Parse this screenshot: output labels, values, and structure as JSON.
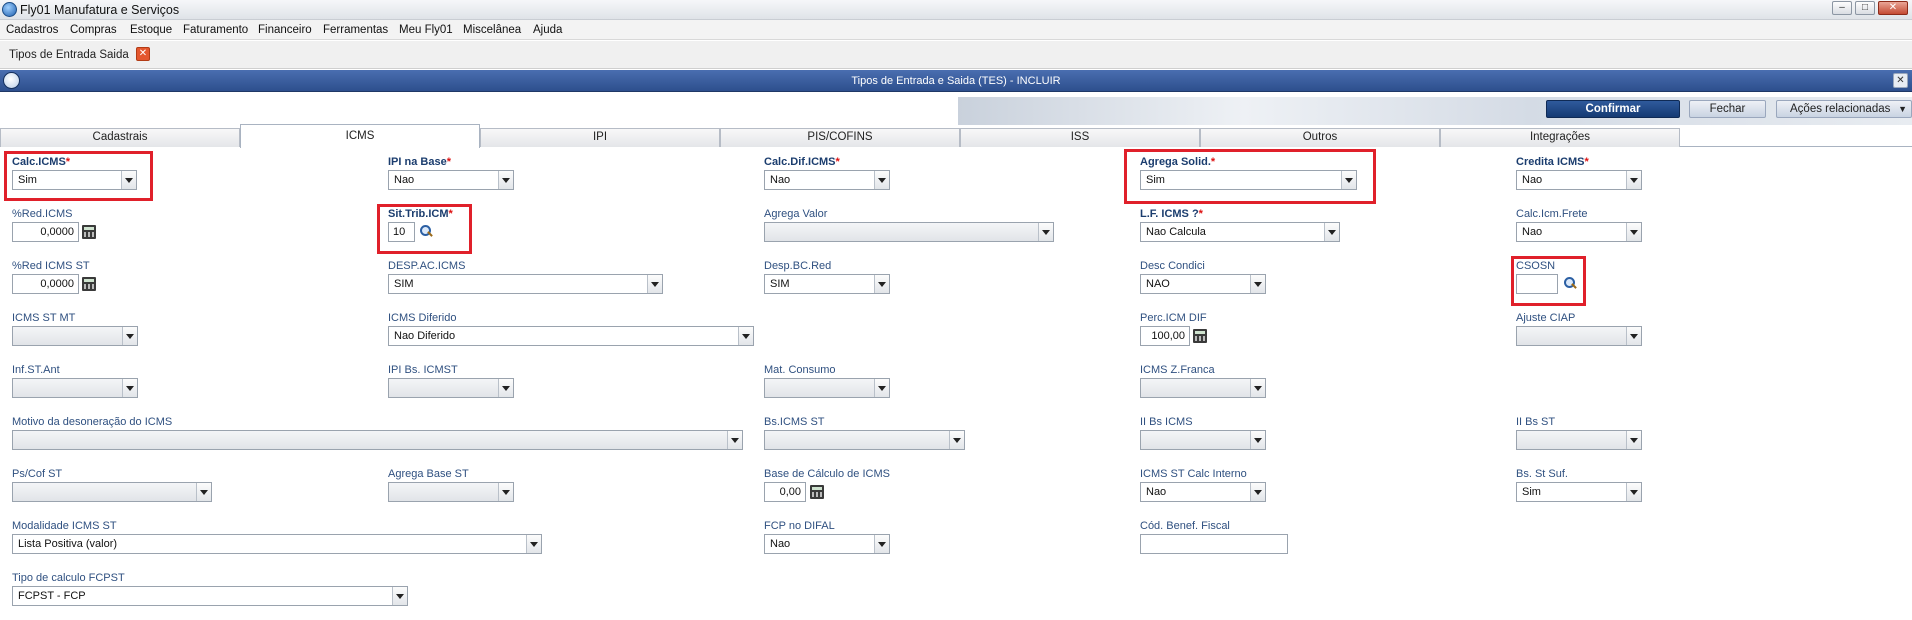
{
  "app": {
    "title": "Fly01 Manufatura e Serviços"
  },
  "menu": [
    "Cadastros",
    "Compras",
    "Estoque",
    "Faturamento",
    "Financeiro",
    "Ferramentas",
    "Meu Fly01",
    "Miscelânea",
    "Ajuda"
  ],
  "doc_tab": {
    "label": "Tipos de Entrada Saida"
  },
  "window": {
    "title": "Tipos de Entrada e Saida (TES) - INCLUIR"
  },
  "actions": {
    "confirm": "Confirmar",
    "close": "Fechar",
    "related": "Ações relacionadas"
  },
  "tabs": [
    "Cadastrais",
    "ICMS",
    "IPI",
    "PIS/COFINS",
    "ISS",
    "Outros",
    "Integrações"
  ],
  "active_tab": "ICMS",
  "fields": {
    "calc_icms": {
      "label": "Calc.ICMS",
      "value": "Sim"
    },
    "ipi_na_base": {
      "label": "IPI na Base",
      "value": "Nao"
    },
    "calc_dif_icms": {
      "label": "Calc.Dif.ICMS",
      "value": "Nao"
    },
    "agrega_solid": {
      "label": "Agrega Solid.",
      "value": "Sim"
    },
    "credita_icms": {
      "label": "Credita ICMS",
      "value": "Nao"
    },
    "red_icms": {
      "label": "%Red.ICMS",
      "value": "0,0000"
    },
    "sit_trib_icm": {
      "label": "Sit.Trib.ICM",
      "value": "10"
    },
    "agrega_valor": {
      "label": "Agrega Valor",
      "value": ""
    },
    "lf_icms": {
      "label": "L.F. ICMS ?",
      "value": "Nao Calcula"
    },
    "calc_icm_frete": {
      "label": "Calc.Icm.Frete",
      "value": "Nao"
    },
    "red_icms_st": {
      "label": "%Red ICMS ST",
      "value": "0,0000"
    },
    "desp_ac_icms": {
      "label": "DESP.AC.ICMS",
      "value": "SIM"
    },
    "desp_bc_red": {
      "label": "Desp.BC.Red",
      "value": "SIM"
    },
    "desc_condici": {
      "label": "Desc Condici",
      "value": "NAO"
    },
    "csosn": {
      "label": "CSOSN",
      "value": ""
    },
    "icms_st_mt": {
      "label": "ICMS ST MT",
      "value": ""
    },
    "icms_diferido": {
      "label": "ICMS Diferido",
      "value": "Nao Diferido"
    },
    "perc_icm_dif": {
      "label": "Perc.ICM DIF",
      "value": "100,00"
    },
    "ajuste_ciap": {
      "label": "Ajuste CIAP",
      "value": ""
    },
    "inf_st_ant": {
      "label": "Inf.ST.Ant",
      "value": ""
    },
    "ipi_bs_icmst": {
      "label": "IPI Bs. ICMST",
      "value": ""
    },
    "mat_consumo": {
      "label": "Mat. Consumo",
      "value": ""
    },
    "icms_z_franca": {
      "label": "ICMS Z.Franca",
      "value": ""
    },
    "motivo_deson": {
      "label": "Motivo da desoneração do ICMS",
      "value": ""
    },
    "bs_icms_st": {
      "label": "Bs.ICMS ST",
      "value": ""
    },
    "ii_bs_icms": {
      "label": "II Bs ICMS",
      "value": ""
    },
    "ii_bs_st": {
      "label": "II Bs ST",
      "value": ""
    },
    "ps_cof_st": {
      "label": "Ps/Cof ST",
      "value": ""
    },
    "agrega_base_st": {
      "label": "Agrega Base ST",
      "value": ""
    },
    "base_calc_icms": {
      "label": "Base de Cálculo de ICMS",
      "value": "0,00"
    },
    "icms_st_calc_interno": {
      "label": "ICMS ST Calc Interno",
      "value": "Nao"
    },
    "bs_st_suf": {
      "label": "Bs. St Suf.",
      "value": "Sim"
    },
    "modalidade_icms_st": {
      "label": "Modalidade ICMS ST",
      "value": "Lista Positiva (valor)"
    },
    "fcp_no_difal": {
      "label": "FCP no DIFAL",
      "value": "Nao"
    },
    "cod_benef_fiscal": {
      "label": "Cód. Benef. Fiscal",
      "value": ""
    },
    "tipo_calc_fcpst": {
      "label": "Tipo de calculo FCPST",
      "value": "FCPST -  FCP"
    }
  },
  "required_mark": "*"
}
